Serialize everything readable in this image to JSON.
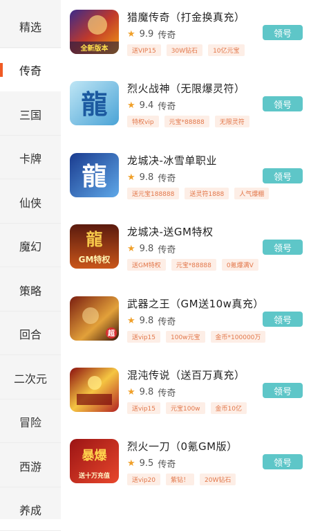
{
  "sidebar": {
    "categories": [
      "精选",
      "传奇",
      "三国",
      "卡牌",
      "仙侠",
      "魔幻",
      "策略",
      "回合",
      "二次元",
      "冒险",
      "西游",
      "养成"
    ],
    "active": "传奇"
  },
  "games": [
    {
      "title": "猎魔传奇（打金换真充）",
      "score": "9.9",
      "genre": "传奇",
      "tags": [
        "送VIP15",
        "30W钻石",
        "10亿元宝"
      ],
      "button": "领号",
      "thumb_text": "全新版本"
    },
    {
      "title": "烈火战神（无限爆灵符）",
      "score": "9.4",
      "genre": "传奇",
      "tags": [
        "特权vip",
        "元宝*88888",
        "无限灵符"
      ],
      "button": "领号",
      "thumb_text": "龍"
    },
    {
      "title": "龙城决-冰雪单职业",
      "score": "9.8",
      "genre": "传奇",
      "tags": [
        "送元宝188888",
        "送灵符1888",
        "人气爆棚"
      ],
      "button": "领号",
      "thumb_text": "龍"
    },
    {
      "title": "龙城决-送GM特权",
      "score": "9.8",
      "genre": "传奇",
      "tags": [
        "送GM特权",
        "元宝*88888",
        "0氪爆满V"
      ],
      "button": "领号",
      "thumb_text": "GM特权"
    },
    {
      "title": "武器之王（GM送10w真充）",
      "score": "9.8",
      "genre": "传奇",
      "tags": [
        "送vip15",
        "100w元宝",
        "金币*100000万"
      ],
      "button": "领号",
      "thumb_text": "超"
    },
    {
      "title": "混沌传说（送百万真充）",
      "score": "9.8",
      "genre": "传奇",
      "tags": [
        "送vip15",
        "元宝100w",
        "金币10亿"
      ],
      "button": "领号",
      "thumb_text": ""
    },
    {
      "title": "烈火一刀（0氪GM版）",
      "score": "9.5",
      "genre": "传奇",
      "tags": [
        "送vip20",
        "紫钻！",
        "20W钻石"
      ],
      "button": "领号",
      "thumb_text": "送十万充值"
    }
  ],
  "colors": {
    "accent": "#f05a24",
    "button": "#5ec6c8",
    "tag_text": "#e2774a",
    "tag_bg": "#fdeee6",
    "star": "#f0a02a"
  }
}
